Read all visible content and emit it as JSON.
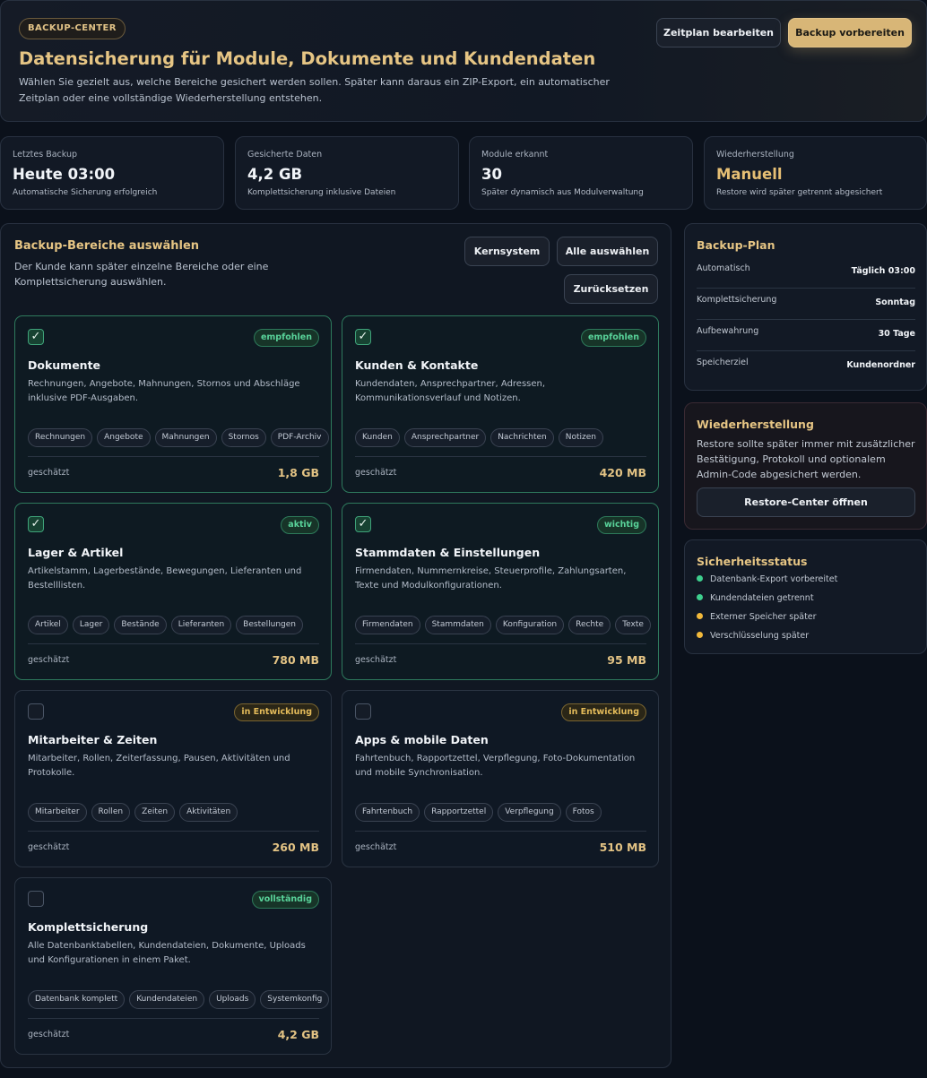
{
  "header": {
    "badge": "BACKUP-CENTER",
    "title": "Datensicherung für Module, Dokumente und Kundendaten",
    "description": "Wählen Sie gezielt aus, welche Bereiche gesichert werden sollen. Später kann daraus ein ZIP-Export, ein automatischer Zeitplan oder eine vollständige Wiederherstellung entstehen.",
    "edit_schedule_label": "Zeitplan bearbeiten",
    "prepare_backup_label": "Backup vorbereiten"
  },
  "stats": [
    {
      "label": "Letztes Backup",
      "value": "Heute 03:00",
      "sub": "Automatische Sicherung erfolgreich"
    },
    {
      "label": "Gesicherte Daten",
      "value": "4,2 GB",
      "sub": "Komplettsicherung inklusive Dateien"
    },
    {
      "label": "Module erkannt",
      "value": "30",
      "sub": "Später dynamisch aus Modulverwaltung"
    },
    {
      "label": "Wiederherstellung",
      "value": "Manuell",
      "sub": "Restore wird später getrennt abgesichert"
    }
  ],
  "selection": {
    "title": "Backup-Bereiche auswählen",
    "description": "Der Kunde kann später einzelne Bereiche oder eine Komplettsicherung auswählen.",
    "core_label": "Kernsystem",
    "select_all_label": "Alle auswählen",
    "reset_label": "Zurücksetzen"
  },
  "cards": [
    {
      "title": "Dokumente",
      "status": "empfohlen",
      "status_tone": "green",
      "checked": true,
      "check_mark": "✓",
      "description": "Rechnungen, Angebote, Mahnungen, Stornos und Abschläge inklusive PDF-Ausgaben.",
      "tags": [
        "Rechnungen",
        "Angebote",
        "Mahnungen",
        "Stornos",
        "PDF-Archiv"
      ],
      "estimate_label": "geschätzt",
      "size": "1,8 GB"
    },
    {
      "title": "Kunden & Kontakte",
      "status": "empfohlen",
      "status_tone": "green",
      "checked": true,
      "check_mark": "✓",
      "description": "Kundendaten, Ansprechpartner, Adressen, Kommunikationsverlauf und Notizen.",
      "tags": [
        "Kunden",
        "Ansprechpartner",
        "Nachrichten",
        "Notizen"
      ],
      "estimate_label": "geschätzt",
      "size": "420 MB"
    },
    {
      "title": "Lager & Artikel",
      "status": "aktiv",
      "status_tone": "green",
      "checked": true,
      "check_mark": "✓",
      "description": "Artikelstamm, Lagerbestände, Bewegungen, Lieferanten und Bestelllisten.",
      "tags": [
        "Artikel",
        "Lager",
        "Bestände",
        "Lieferanten",
        "Bestellungen"
      ],
      "estimate_label": "geschätzt",
      "size": "780 MB"
    },
    {
      "title": "Stammdaten & Einstellungen",
      "status": "wichtig",
      "status_tone": "green",
      "checked": true,
      "check_mark": "✓",
      "description": "Firmendaten, Nummernkreise, Steuerprofile, Zahlungsarten, Texte und Modulkonfigurationen.",
      "tags": [
        "Firmendaten",
        "Stammdaten",
        "Konfiguration",
        "Rechte",
        "Texte"
      ],
      "estimate_label": "geschätzt",
      "size": "95 MB"
    },
    {
      "title": "Mitarbeiter & Zeiten",
      "status": "in Entwicklung",
      "status_tone": "amber",
      "checked": false,
      "check_mark": "",
      "description": "Mitarbeiter, Rollen, Zeiterfassung, Pausen, Aktivitäten und Protokolle.",
      "tags": [
        "Mitarbeiter",
        "Rollen",
        "Zeiten",
        "Aktivitäten"
      ],
      "estimate_label": "geschätzt",
      "size": "260 MB"
    },
    {
      "title": "Apps & mobile Daten",
      "status": "in Entwicklung",
      "status_tone": "amber",
      "checked": false,
      "check_mark": "",
      "description": "Fahrtenbuch, Rapportzettel, Verpflegung, Foto-Dokumentation und mobile Synchronisation.",
      "tags": [
        "Fahrtenbuch",
        "Rapportzettel",
        "Verpflegung",
        "Fotos"
      ],
      "estimate_label": "geschätzt",
      "size": "510 MB"
    },
    {
      "title": "Komplettsicherung",
      "status": "vollständig",
      "status_tone": "green",
      "checked": false,
      "check_mark": "",
      "description": "Alle Datenbanktabellen, Kundendateien, Dokumente, Uploads und Konfigurationen in einem Paket.",
      "tags": [
        "Datenbank komplett",
        "Kundendateien",
        "Uploads",
        "Systemkonfig"
      ],
      "estimate_label": "geschätzt",
      "size": "4,2 GB"
    }
  ],
  "plan": {
    "title": "Backup-Plan",
    "rows": [
      {
        "key": "Automatisch",
        "value": "Täglich 03:00"
      },
      {
        "key": "Komplettsicherung",
        "value": "Sonntag"
      },
      {
        "key": "Aufbewahrung",
        "value": "30 Tage"
      },
      {
        "key": "Speicherziel",
        "value": "Kundenordner"
      }
    ]
  },
  "restore": {
    "title": "Wiederherstellung",
    "description": "Restore sollte später immer mit zusätzlicher Bestätigung, Protokoll und optionalem Admin-Code abgesichert werden.",
    "button_label": "Restore-Center öffnen"
  },
  "security": {
    "title": "Sicherheitsstatus",
    "items": [
      {
        "label": "Datenbank-Export vorbereitet",
        "color": "#3ecf8e"
      },
      {
        "label": "Kundendateien getrennt",
        "color": "#3ecf8e"
      },
      {
        "label": "Externer Speicher später",
        "color": "#f2b93b"
      },
      {
        "label": "Verschlüsselung später",
        "color": "#f2b93b"
      }
    ]
  },
  "colors": {
    "accent": "#e6c584",
    "gold_button": "#d8b677",
    "success": "#3ecf8e",
    "warning": "#f2b93b"
  }
}
